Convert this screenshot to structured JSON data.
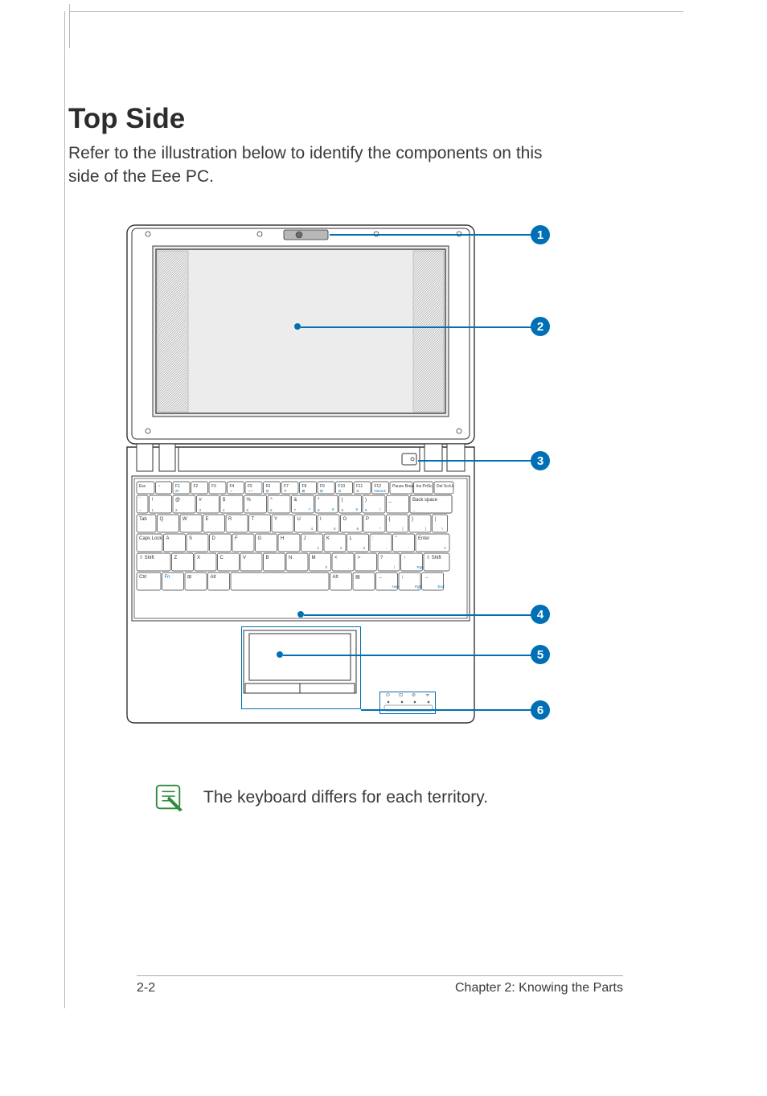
{
  "heading": "Top Side",
  "intro": "Refer to the illustration below to identify the components on this side of the Eee PC.",
  "callouts": {
    "c1": "1",
    "c2": "2",
    "c3": "3",
    "c4": "4",
    "c5": "5",
    "c6": "6"
  },
  "keyboard": {
    "row_fn": [
      "Esc",
      "~",
      "F1",
      "F2",
      "F3",
      "F4",
      "F5",
      "F6",
      "F7",
      "F8",
      "F9",
      "F10",
      "F11",
      "F12",
      "Pause Break",
      "Ins PrtSc",
      "Del ScrLk"
    ],
    "row_fn_sub": [
      "",
      "",
      "Zz",
      "",
      "",
      "☼",
      "☼+",
      "⊟",
      "✕",
      "⊠",
      "⊞",
      "⊡",
      "⊘",
      "NumLk",
      "",
      "",
      ""
    ],
    "row_num_top": [
      "!",
      "@",
      "#",
      "$",
      "%",
      "^",
      "&",
      "*",
      "(",
      ")",
      "_",
      "+",
      "Back space"
    ],
    "row_num_bot": [
      "1",
      "2",
      "3",
      "4",
      "5",
      "6",
      "7",
      "8",
      "9",
      "0",
      "-",
      "=",
      ""
    ],
    "row_num_accent": [
      "",
      "",
      "",
      "",
      "",
      "",
      "7",
      "8",
      "9",
      "/",
      "",
      "",
      ""
    ],
    "row_q": [
      "Tab",
      "Q",
      "W",
      "E",
      "R",
      "T",
      "Y",
      "U",
      "I",
      "O",
      "P",
      "{",
      "}",
      "|"
    ],
    "row_q_accent": [
      "",
      "",
      "",
      "",
      "",
      "",
      "",
      "4",
      "5",
      "6",
      "*",
      "[",
      "]",
      "\\"
    ],
    "row_a": [
      "Caps Lock",
      "A",
      "S",
      "D",
      "F",
      "G",
      "H",
      "J",
      "K",
      "L",
      ":",
      "\"",
      "Enter"
    ],
    "row_a_accent": [
      "",
      "",
      "",
      "",
      "",
      "",
      "",
      "1",
      "2",
      "3",
      ";",
      "'",
      "↵"
    ],
    "row_z": [
      "⇧ Shift",
      "Z",
      "X",
      "C",
      "V",
      "B",
      "N",
      "M",
      "<",
      ">",
      "?",
      "↑",
      "⇧ Shift"
    ],
    "row_z_accent": [
      "",
      "",
      "",
      "",
      "",
      "",
      "",
      "0",
      ",",
      ".",
      "/",
      "PgUp",
      ""
    ],
    "row_ctrl": [
      "Ctrl",
      "Fn",
      "⊞",
      "Alt",
      "",
      "Alt",
      "▤",
      "←",
      "↓",
      "→"
    ],
    "row_ctrl_accent": [
      "",
      "",
      "",
      "",
      "",
      "",
      "",
      "Home",
      "PgDn",
      "End"
    ]
  },
  "note": "The keyboard differs for each territory.",
  "footer": {
    "left": "2-2",
    "right": "Chapter 2: Knowing the Parts"
  }
}
